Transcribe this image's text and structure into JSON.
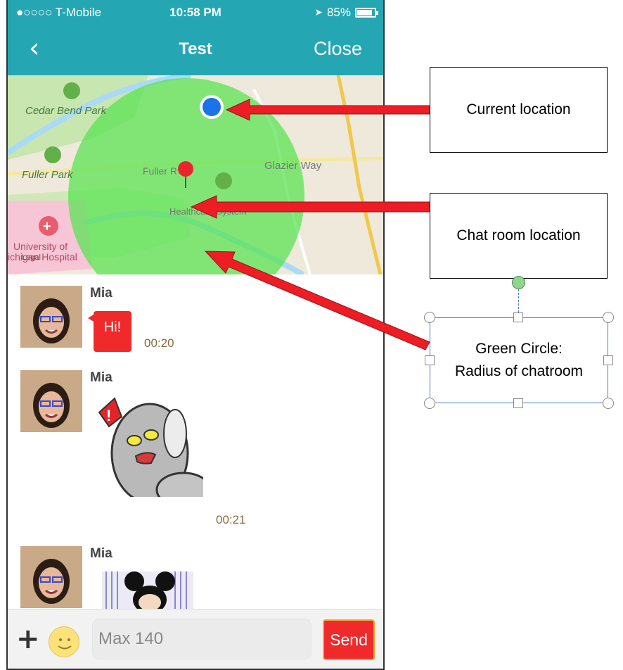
{
  "status_bar": {
    "carrier": "●○○○○ T-Mobile",
    "time": "10:58 PM",
    "battery": "85%"
  },
  "nav": {
    "back_glyph": "‹",
    "title": "Test",
    "close_label": "Close"
  },
  "map": {
    "labels": {
      "cedar_bend_park": "Cedar Bend Park",
      "fuller_park": "Fuller Park",
      "fuller_road": "Fuller R",
      "glazier_way": "Glazier Way",
      "healthcare_system": "Healthcare System",
      "university_hospital_line1": "University of",
      "university_hospital_line2": "ichigan Hospital",
      "legal": "Legal"
    },
    "colors": {
      "radius_circle": "#56e34f",
      "current_location_dot": "#1a73e8",
      "chatroom_pin": "#e8262b"
    }
  },
  "messages": [
    {
      "sender": "Mia",
      "text": "Hi!",
      "time": "00:20",
      "type": "text"
    },
    {
      "sender": "Mia",
      "time": "00:21",
      "type": "sticker",
      "sticker": "angry-moon-sticker"
    },
    {
      "sender": "Mia",
      "type": "sticker",
      "sticker": "mickey-sticker"
    }
  ],
  "input_bar": {
    "plus_glyph": "+",
    "placeholder": "Max 140",
    "send_label": "Send"
  },
  "annotations": {
    "current_location": "Current location",
    "chat_room_location": "Chat room location",
    "green_circle_line1": "Green Circle:",
    "green_circle_line2": "Radius of chatroom",
    "arrow_color": "#ee1c24"
  }
}
